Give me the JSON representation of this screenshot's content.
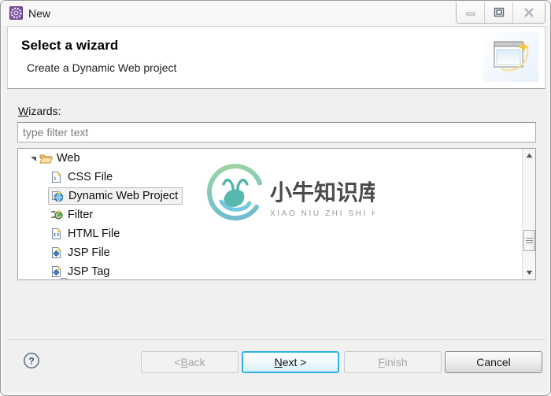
{
  "window": {
    "title": "New",
    "app_icon": "eclipse-wizard-icon",
    "controls": [
      {
        "name": "minimize-button",
        "glyph": "minimize-icon"
      },
      {
        "name": "maximize-button",
        "glyph": "maximize-icon"
      },
      {
        "name": "close-button",
        "glyph": "close-icon"
      }
    ],
    "accent_color": "#2eb3e4",
    "icon_color": "#7c51a1"
  },
  "header": {
    "title": "Select a wizard",
    "subtitle": "Create a Dynamic Web project",
    "art_icon": "new-window-sparkle-icon"
  },
  "main": {
    "wizards_label_mnemonic": "W",
    "wizards_label_rest": "izards:",
    "filter": {
      "value": "",
      "placeholder": "type filter text"
    },
    "tree": [
      {
        "label": "Web",
        "level": 0,
        "expanded": true,
        "icon": "folder-open-icon",
        "selected": false
      },
      {
        "label": "CSS File",
        "level": 1,
        "icon": "css-file-icon",
        "selected": false
      },
      {
        "label": "Dynamic Web Project",
        "level": 1,
        "icon": "dynamic-web-project-icon",
        "selected": true
      },
      {
        "label": "Filter",
        "level": 1,
        "icon": "filter-icon",
        "selected": false
      },
      {
        "label": "HTML File",
        "level": 1,
        "icon": "html-file-icon",
        "selected": false
      },
      {
        "label": "JSP File",
        "level": 1,
        "icon": "jsp-file-icon",
        "selected": false
      },
      {
        "label": "JSP Tag",
        "level": 1,
        "icon": "jsp-tag-icon",
        "selected": false
      }
    ],
    "scrollbar": {
      "up_arrow": "scroll-up-icon",
      "down_arrow": "scroll-down-icon"
    },
    "watermark": {
      "text_cn": "小牛知识库",
      "text_pinyin": "XIAO NIU ZHI SHI KU"
    }
  },
  "footer": {
    "help_icon": "help-question-icon",
    "buttons": [
      {
        "name": "back-button",
        "prefix": "< ",
        "mnemonic": "B",
        "suffix": "ack",
        "state": "disabled"
      },
      {
        "name": "next-button",
        "prefix": "",
        "mnemonic": "N",
        "suffix": "ext >",
        "state": "primary"
      },
      {
        "name": "finish-button",
        "prefix": "",
        "mnemonic": "F",
        "suffix": "inish",
        "state": "disabled"
      },
      {
        "name": "cancel-button",
        "prefix": "",
        "mnemonic": "",
        "suffix": "Cancel",
        "state": "normal"
      }
    ]
  }
}
